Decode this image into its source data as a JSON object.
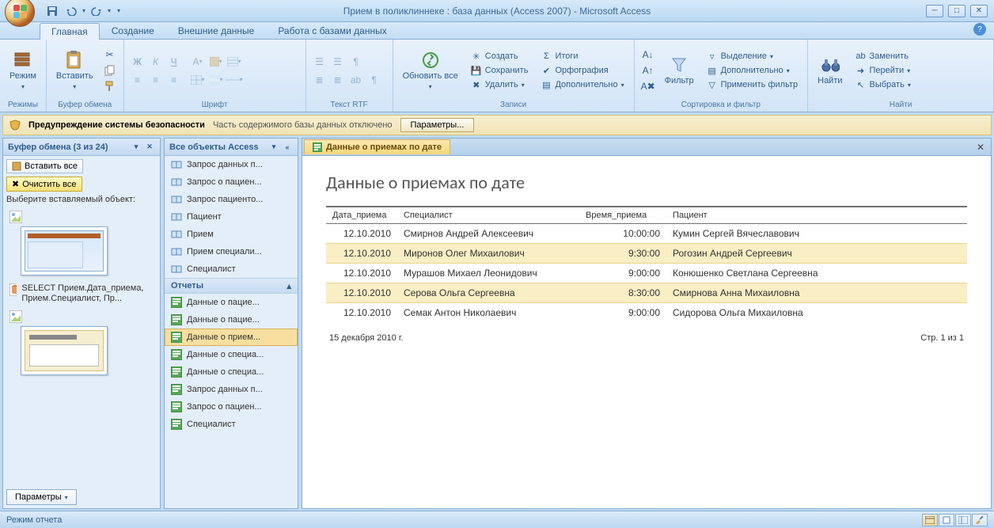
{
  "title": "Прием в поликлиннеке : база данных (Access 2007) - Microsoft Access",
  "tabs": {
    "home": "Главная",
    "create": "Создание",
    "external": "Внешние данные",
    "dbtools": "Работа с базами данных"
  },
  "ribbon": {
    "groups": {
      "views": "Режимы",
      "clipboard": "Буфер обмена",
      "font": "Шрифт",
      "rtf": "Текст RTF",
      "records": "Записи",
      "sortfilter": "Сортировка и фильтр",
      "find": "Найти"
    },
    "view_btn": "Режим",
    "paste_btn": "Вставить",
    "refresh_btn": "Обновить все",
    "records": {
      "new": "Создать",
      "save": "Сохранить",
      "delete": "Удалить",
      "totals": "Итоги",
      "spelling": "Орфография",
      "more": "Дополнительно"
    },
    "filter_btn": "Фильтр",
    "sortfilter": {
      "selection": "Выделение",
      "advanced": "Дополнительно",
      "toggle": "Применить фильтр"
    },
    "find_btn": "Найти",
    "find": {
      "replace": "Заменить",
      "goto": "Перейти",
      "select": "Выбрать"
    }
  },
  "security": {
    "title": "Предупреждение системы безопасности",
    "msg": "Часть содержимого базы данных отключено",
    "options": "Параметры..."
  },
  "clipboard_pane": {
    "title": "Буфер обмена (3 из 24)",
    "paste_all": "Вставить все",
    "clear_all": "Очистить все",
    "hint": "Выберите вставляемый объект:",
    "item2_text": "SELECT Прием.Дата_приема, Прием.Специалист, Пр...",
    "params": "Параметры"
  },
  "nav": {
    "title": "Все объекты Access",
    "sections": {
      "reports": "Отчеты"
    },
    "queries": [
      "Запрос данных п...",
      "Запрос о пациен...",
      "Запрос пациенто...",
      "Пациент",
      "Прием",
      "Прием специали...",
      "Специалист"
    ],
    "reports": [
      "Данные о пацие...",
      "Данные о пацие...",
      "Данные о прием...",
      "Данные о специа...",
      "Данные о специа...",
      "Запрос данных п...",
      "Запрос о пациен...",
      "Специалист"
    ]
  },
  "doc_tab": "Данные о приемах по дате",
  "report": {
    "title": "Данные о приемах по дате",
    "headers": {
      "date": "Дата_приема",
      "spec": "Специалист",
      "time": "Время_приема",
      "patient": "Пациент"
    },
    "rows": [
      {
        "date": "12.10.2010",
        "spec": "Смирнов Андрей Алексеевич",
        "time": "10:00:00",
        "patient": "Кумин Сергей Вячеславович"
      },
      {
        "date": "12.10.2010",
        "spec": "Миронов Олег Михаилович",
        "time": "9:30:00",
        "patient": "Рогозин Андрей Сергеевич"
      },
      {
        "date": "12.10.2010",
        "spec": "Мурашов Михаел Леонидович",
        "time": "9:00:00",
        "patient": "Конюшенко Светлана Сергеевна"
      },
      {
        "date": "12.10.2010",
        "spec": "Серова Ольга Сергеевна",
        "time": "8:30:00",
        "patient": "Смирнова Анна Михаиловна"
      },
      {
        "date": "12.10.2010",
        "spec": "Семак Антон Николаевич",
        "time": "9:00:00",
        "patient": "Сидорова Ольга Михаиловна"
      }
    ],
    "footer_date": "15 декабря 2010 г.",
    "footer_page": "Стр. 1 из 1"
  },
  "statusbar": "Режим отчета"
}
